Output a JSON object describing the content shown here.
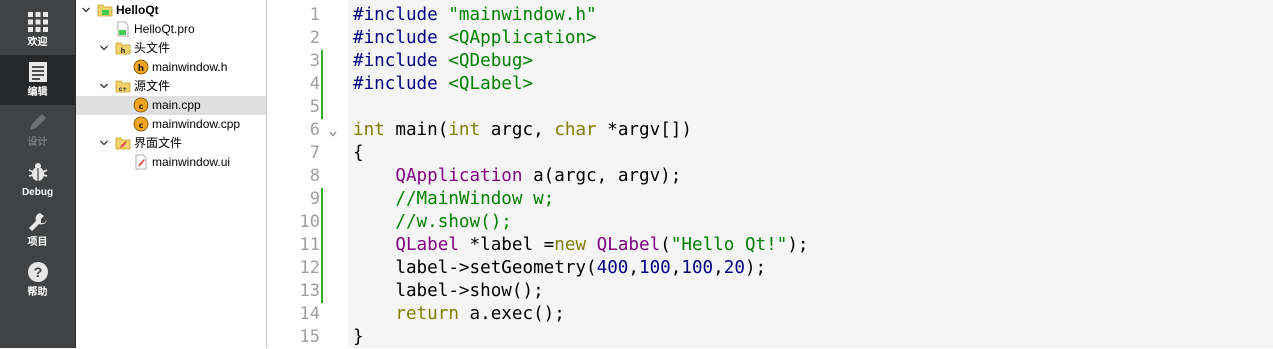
{
  "modebar": {
    "items": [
      {
        "label": "欢迎",
        "icon": "grid-icon"
      },
      {
        "label": "编辑",
        "icon": "document-icon"
      },
      {
        "label": "设计",
        "icon": "pencil-icon"
      },
      {
        "label": "Debug",
        "icon": "bug-icon"
      },
      {
        "label": "项目",
        "icon": "wrench-icon"
      },
      {
        "label": "帮助",
        "icon": "help-icon"
      }
    ],
    "active_index": 1,
    "colors": {
      "bar": "#404244",
      "active": "#262829"
    }
  },
  "project_tree": {
    "rows": [
      {
        "label": "HelloQt",
        "bold": true,
        "expandable": true,
        "icon": "qt-project-icon"
      },
      {
        "label": "HelloQt.pro",
        "icon": "pro-file-icon"
      },
      {
        "label": "头文件",
        "expandable": true,
        "icon": "header-folder-icon"
      },
      {
        "label": "mainwindow.h",
        "icon": "h-file-icon"
      },
      {
        "label": "源文件",
        "expandable": true,
        "icon": "source-folder-icon"
      },
      {
        "label": "main.cpp",
        "selected": true,
        "icon": "cpp-file-icon"
      },
      {
        "label": "mainwindow.cpp",
        "icon": "cpp-file-icon"
      },
      {
        "label": "界面文件",
        "expandable": true,
        "icon": "forms-folder-icon"
      },
      {
        "label": "mainwindow.ui",
        "icon": "ui-file-icon"
      }
    ]
  },
  "editor": {
    "line_numbers": [
      "1",
      "2",
      "3",
      "4",
      "5",
      "6",
      "7",
      "8",
      "9",
      "10",
      "11",
      "12",
      "13",
      "14",
      "15"
    ],
    "lines": [
      [
        {
          "t": "#include ",
          "c": "pp"
        },
        {
          "t": "\"mainwindow.h\"",
          "c": "str"
        }
      ],
      [
        {
          "t": "#include ",
          "c": "pp"
        },
        {
          "t": "<QApplication>",
          "c": "str"
        }
      ],
      [
        {
          "t": "#include ",
          "c": "pp"
        },
        {
          "t": "<QDebug>",
          "c": "str"
        }
      ],
      [
        {
          "t": "#include ",
          "c": "pp"
        },
        {
          "t": "<QLabel>",
          "c": "str"
        }
      ],
      [],
      [
        {
          "t": "int",
          "c": "kw"
        },
        {
          "t": " main(",
          "c": "plain"
        },
        {
          "t": "int",
          "c": "kw"
        },
        {
          "t": " argc, ",
          "c": "plain"
        },
        {
          "t": "char",
          "c": "kw"
        },
        {
          "t": " *argv[])",
          "c": "plain"
        }
      ],
      [
        {
          "t": "{",
          "c": "plain"
        }
      ],
      [
        {
          "t": "    ",
          "c": "plain"
        },
        {
          "t": "QApplication",
          "c": "cls"
        },
        {
          "t": " a(argc, argv);",
          "c": "plain"
        }
      ],
      [
        {
          "t": "    //MainWindow w;",
          "c": "cmt"
        }
      ],
      [
        {
          "t": "    //w.show();",
          "c": "cmt"
        }
      ],
      [
        {
          "t": "    ",
          "c": "plain"
        },
        {
          "t": "QLabel",
          "c": "cls"
        },
        {
          "t": " *label =",
          "c": "plain"
        },
        {
          "t": "new",
          "c": "kw"
        },
        {
          "t": " ",
          "c": "plain"
        },
        {
          "t": "QLabel",
          "c": "cls"
        },
        {
          "t": "(",
          "c": "plain"
        },
        {
          "t": "\"Hello Qt!\"",
          "c": "str"
        },
        {
          "t": ");",
          "c": "plain"
        }
      ],
      [
        {
          "t": "    label->setGeometry(",
          "c": "plain"
        },
        {
          "t": "400",
          "c": "num"
        },
        {
          "t": ",",
          "c": "plain"
        },
        {
          "t": "100",
          "c": "num"
        },
        {
          "t": ",",
          "c": "plain"
        },
        {
          "t": "100",
          "c": "num"
        },
        {
          "t": ",",
          "c": "plain"
        },
        {
          "t": "20",
          "c": "num"
        },
        {
          "t": ");",
          "c": "plain"
        }
      ],
      [
        {
          "t": "    label->show();",
          "c": "plain"
        }
      ],
      [
        {
          "t": "    ",
          "c": "plain"
        },
        {
          "t": "return",
          "c": "kw"
        },
        {
          "t": " a.exec();",
          "c": "plain"
        }
      ],
      [
        {
          "t": "}",
          "c": "plain"
        }
      ]
    ],
    "changed_lines": [
      3,
      4,
      5,
      9,
      10,
      11,
      12,
      13
    ],
    "colors": {
      "background": "#f5f5f5",
      "preprocessor": "#000080",
      "string": "#008000",
      "keyword": "#808000",
      "type": "#800080",
      "number": "#000080",
      "comment": "#008000",
      "change_marker": "#2eaa2e"
    }
  }
}
